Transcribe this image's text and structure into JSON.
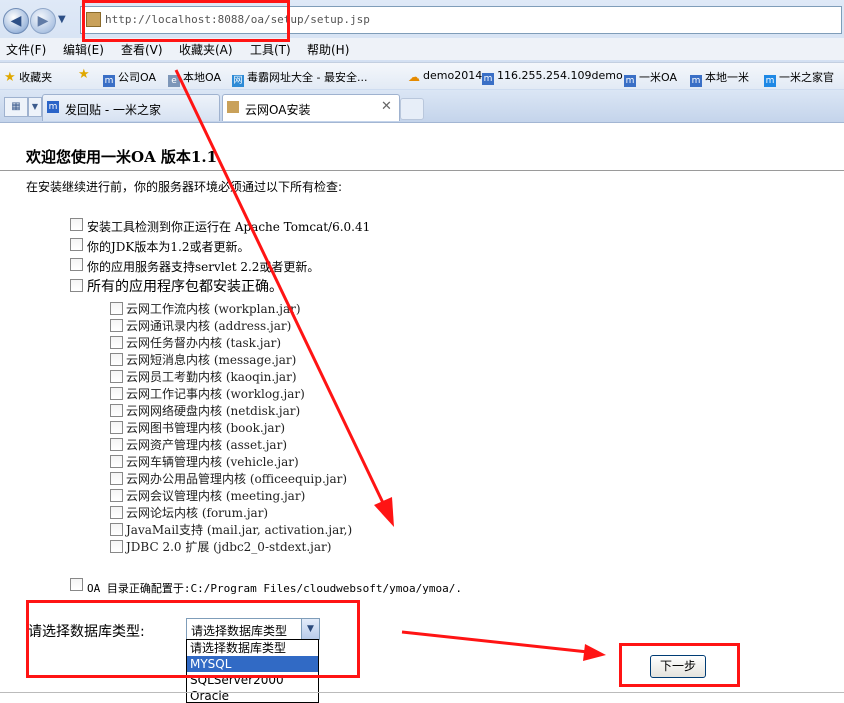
{
  "browser": {
    "url": "http://localhost:8088/oa/setup/setup.jsp",
    "menu": [
      "文件(F)",
      "编辑(E)",
      "查看(V)",
      "收藏夹(A)",
      "工具(T)",
      "帮助(H)"
    ],
    "favorites_label": "收藏夹",
    "favorites": [
      "公司OA",
      "本地OA",
      "毒霸网址大全 - 最安全...",
      "demo2014",
      "116.255.254.109demo",
      "一米OA",
      "本地一米",
      "一米之家官"
    ],
    "tabs": [
      "发回贴 - 一米之家",
      "云网OA安装"
    ]
  },
  "page": {
    "heading": "欢迎您使用一米OA 版本1.1",
    "intro": "在安装继续进行前，你的服务器环境必须通过以下所有检查:",
    "checks": [
      "安装工具检测到你正运行在  Apache Tomcat/6.0.41",
      "你的JDK版本为1.2或者更新。",
      "你的应用服务器支持servlet 2.2或者更新。",
      "所有的应用程序包都安装正确。"
    ],
    "packages": [
      "云网工作流内核  (workplan.jar)",
      "云网通讯录内核  (address.jar)",
      "云网任务督办内核  (task.jar)",
      "云网短消息内核  (message.jar)",
      "云网员工考勤内核  (kaoqin.jar)",
      "云网工作记事内核  (worklog.jar)",
      "云网网络硬盘内核  (netdisk.jar)",
      "云网图书管理内核  (book.jar)",
      "云网资产管理内核  (asset.jar)",
      "云网车辆管理内核  (vehicle.jar)",
      "云网办公用品管理内核  (officeequip.jar)",
      "云网会议管理内核  (meeting.jar)",
      "云网论坛内核  (forum.jar)",
      "JavaMail支持  (mail.jar, activation.jar,)",
      "JDBC 2.0 扩展  (jdbc2_0-stdext.jar)"
    ],
    "oa_dir": "OA 目录正确配置于:C:/Program Files/cloudwebsoft/ymoa/ymoa/.",
    "db_label": "请选择数据库类型:",
    "db_select_value": "请选择数据库类型",
    "db_options": [
      "请选择数据库类型",
      "MYSQL",
      "SQLServer2000",
      "Oracle"
    ],
    "next_button": "下一步"
  },
  "colors": {
    "annotation": "#ff1414",
    "selected_option": "#316ac5"
  }
}
